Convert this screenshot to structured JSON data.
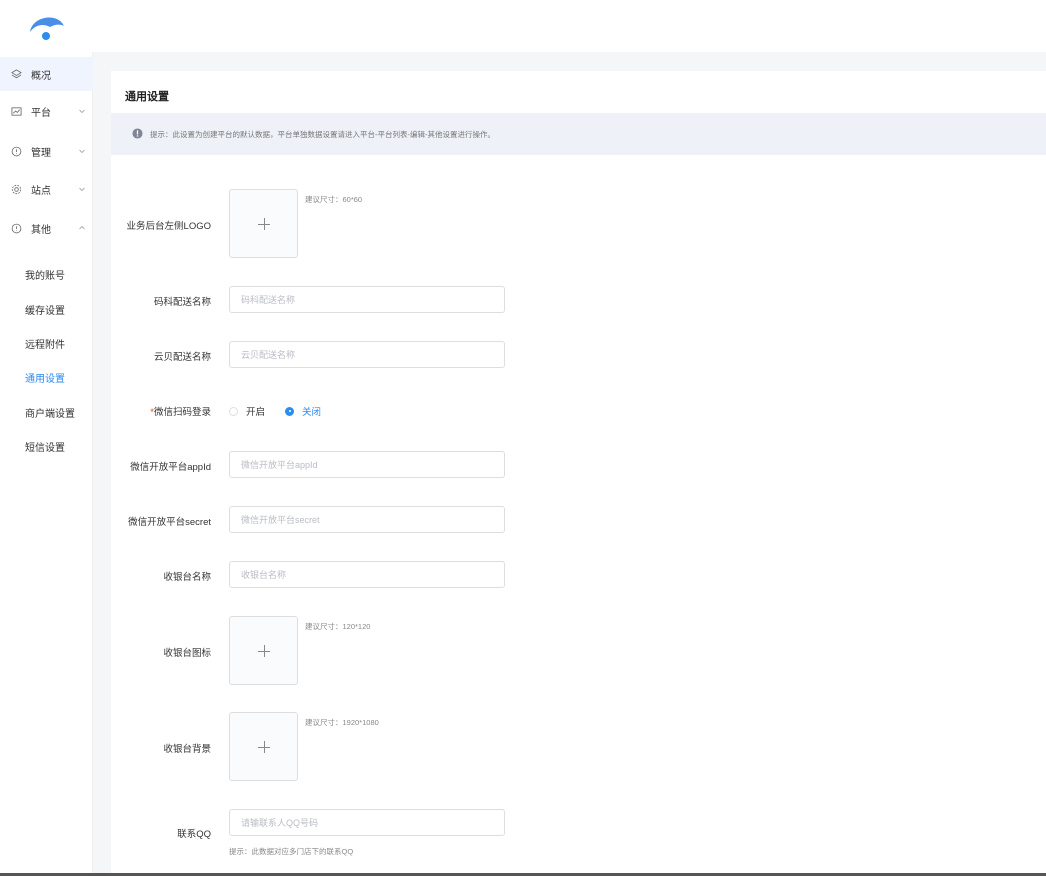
{
  "sidebar": {
    "menu": [
      {
        "label": "概况",
        "icon": "layers-icon"
      },
      {
        "label": "平台",
        "icon": "chart-icon"
      },
      {
        "label": "管理",
        "icon": "shield-icon"
      },
      {
        "label": "站点",
        "icon": "gear-icon"
      },
      {
        "label": "其他",
        "icon": "shield-icon"
      }
    ],
    "sub_items": [
      "我的账号",
      "缓存设置",
      "远程附件",
      "通用设置",
      "商户端设置",
      "短信设置"
    ]
  },
  "main": {
    "title": "通用设置",
    "notice": "提示：此设置为创建平台的默认数据，平台单独数据设置请进入平台-平台列表-编辑-其他设置进行操作。"
  },
  "form": {
    "logo_label": "业务后台左侧LOGO",
    "logo_hint": "建议尺寸：60*60",
    "delivery1_label": "码科配送名称",
    "delivery1_placeholder": "码科配送名称",
    "delivery2_label": "云贝配送名称",
    "delivery2_placeholder": "云贝配送名称",
    "wechat_login_required": "*",
    "wechat_login_label": "微信扫码登录",
    "radio_on": "开启",
    "radio_off": "关闭",
    "appid_label": "微信开放平台appId",
    "appid_placeholder": "微信开放平台appId",
    "secret_label": "微信开放平台secret",
    "secret_placeholder": "微信开放平台secret",
    "cashier_name_label": "收银台名称",
    "cashier_name_placeholder": "收银台名称",
    "cashier_icon_label": "收银台图标",
    "cashier_icon_hint": "建议尺寸：120*120",
    "cashier_bg_label": "收银台背景",
    "cashier_bg_hint": "建议尺寸：1920*1080",
    "qq_label": "联系QQ",
    "qq_placeholder": "请输联系人QQ号码",
    "qq_hint": "提示：此数据对应多门店下的联系QQ",
    "wechat_login_value": "关闭"
  },
  "colors": {
    "accent": "#2d8cf0",
    "brand_logo": "#4a8fe7"
  }
}
